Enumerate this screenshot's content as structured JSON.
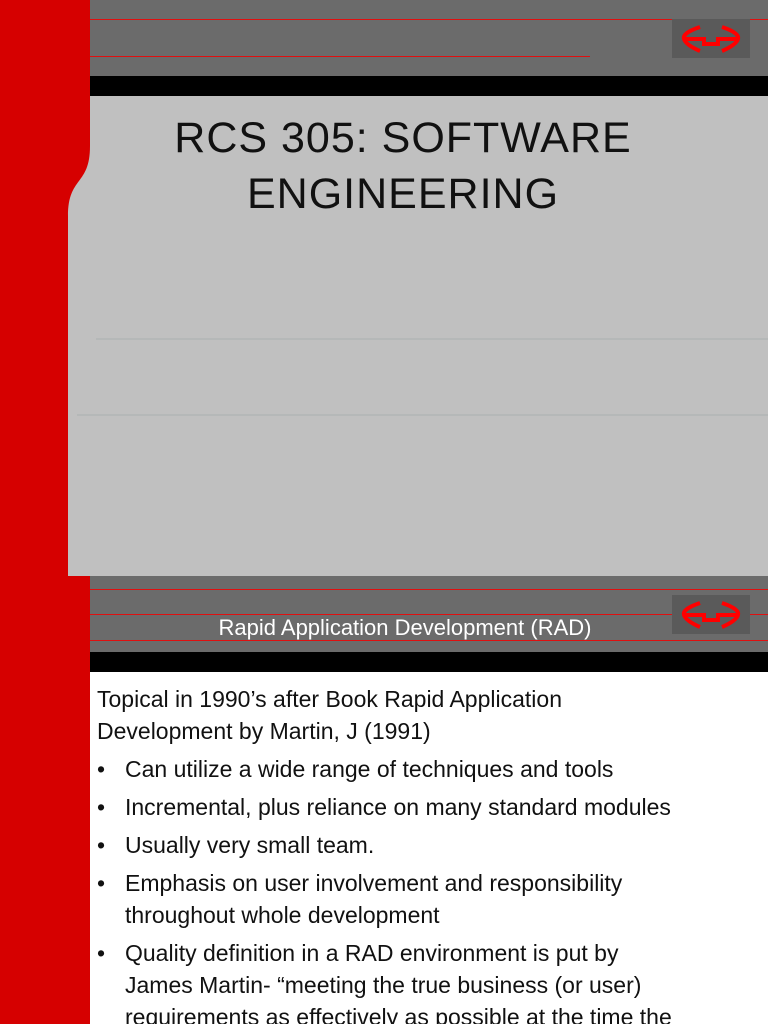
{
  "slide1": {
    "title_line1": "RCS 305: SOFTWARE",
    "title_line2": "ENGINEERING"
  },
  "slide2": {
    "title": "Rapid Application Development (RAD)",
    "intro": [
      "Topical in 1990’s after  Book Rapid Application",
      "Development by Martin, J (1991)"
    ],
    "bullet_char": "•",
    "bullets": [
      [
        "Can utilize a wide range of techniques and tools"
      ],
      [
        "Incremental, plus reliance on many standard modules"
      ],
      [
        "Usually very small team."
      ],
      [
        "Emphasis on user involvement and responsibility",
        "throughout whole development"
      ],
      [
        "Quality definition in a RAD environment is put by",
        "James Martin- “meeting the true business (or user)",
        "requirements as effectively as possible at the time the"
      ]
    ]
  },
  "colors": {
    "red": "#d60000",
    "header_gray": "#6b6b6b",
    "light_gray": "#c0c0c0"
  },
  "icons": {
    "logo": "double-arrow-logo-icon"
  }
}
